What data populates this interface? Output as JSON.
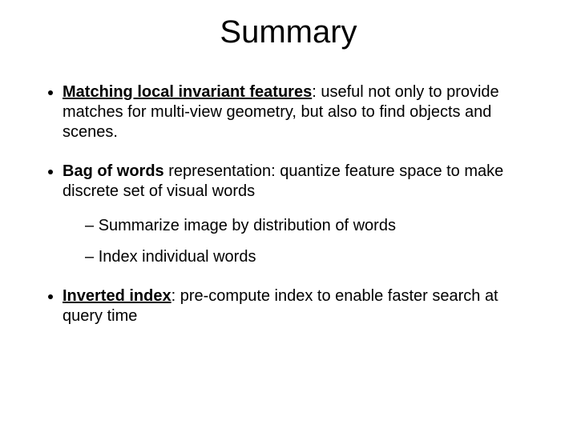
{
  "title": "Summary",
  "bullets": {
    "b1": {
      "lead": "Matching local invariant features",
      "rest": ": useful not only to provide matches for multi-view geometry, but also to find objects and scenes."
    },
    "b2": {
      "lead": "Bag of words",
      "rest": " representation: quantize feature space to make discrete set of visual words",
      "sub1": "Summarize image by distribution of words",
      "sub2": "Index individual words"
    },
    "b3": {
      "lead": "Inverted index",
      "rest": ": pre-compute index to enable faster search at query time"
    }
  }
}
